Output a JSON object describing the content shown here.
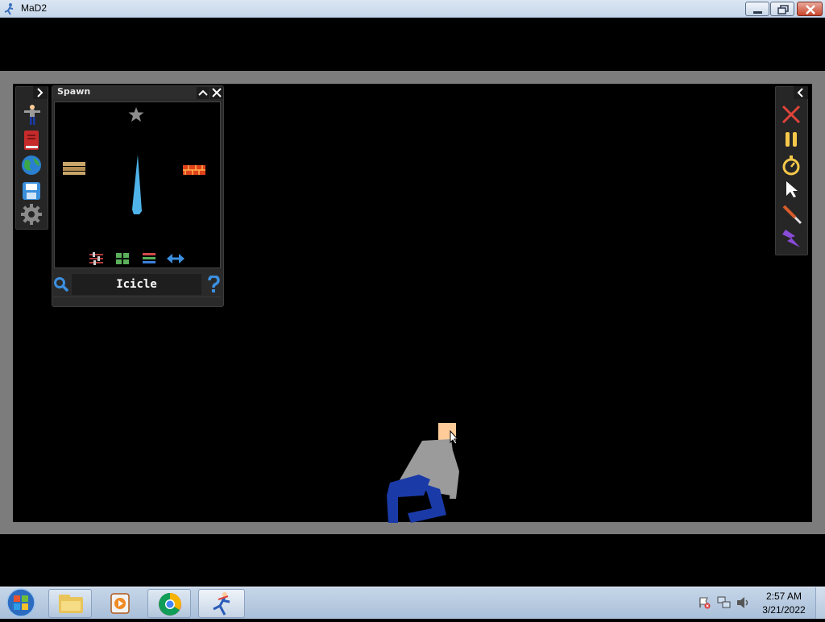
{
  "window": {
    "title": "MaD2",
    "icon": "running-man-icon"
  },
  "spawn_panel": {
    "title": "Spawn",
    "search_value": "Icicle",
    "items": [
      {
        "name": "star-item",
        "icon": "star-icon"
      },
      {
        "name": "wooden-planks-item",
        "icon": "planks-icon"
      },
      {
        "name": "icicle-item",
        "icon": "icicle-icon"
      },
      {
        "name": "brick-item",
        "icon": "brick-icon"
      }
    ],
    "view_modes": [
      "sliders-icon",
      "grid-icon",
      "list-icon",
      "swap-arrows-icon"
    ]
  },
  "left_toolbar": {
    "tools": [
      "ragdoll-tool-icon",
      "book-icon",
      "globe-icon",
      "save-disk-icon",
      "settings-gear-icon"
    ]
  },
  "right_toolbar": {
    "tools": [
      "delete-x-icon",
      "pause-icon",
      "stopwatch-icon",
      "cursor-icon",
      "knife-icon",
      "lightning-icon"
    ]
  },
  "taskbar": {
    "time": "2:57 AM",
    "date": "3/21/2022",
    "apps": [
      "windows-explorer-icon",
      "media-player-icon",
      "chrome-icon",
      "mad2-icon"
    ]
  },
  "colors": {
    "arena_frame": "#7c7c7c",
    "accent_blue": "#2e8be0",
    "close_red": "#e0443a",
    "ragdoll_shirt": "#9b9b9b",
    "ragdoll_pants": "#1a3aa8",
    "ragdoll_skin": "#ffcc99"
  }
}
